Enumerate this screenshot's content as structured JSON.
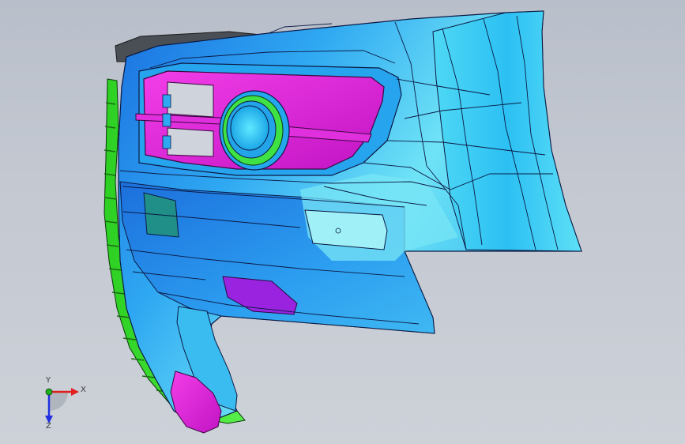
{
  "viewport": {
    "background_top": "#b9bfca",
    "background_bottom": "#cdd1d8"
  },
  "model": {
    "colors": {
      "body_cyan": "#2fb4f0",
      "body_light": "#7fe6f5",
      "body_blue": "#1c7fe6",
      "grille_magenta": "#e81ee0",
      "bracket_green": "#36e62a",
      "top_dark": "#4a4e55",
      "purple_patch": "#9a23e0",
      "teal_patch": "#1f8f88",
      "edge": "#0b1a44"
    }
  },
  "triad": {
    "x_label": "X",
    "y_label": "Y",
    "z_label": "Z",
    "x_color": "#e02020",
    "y_color": "#20b020",
    "z_color": "#2030e0"
  }
}
